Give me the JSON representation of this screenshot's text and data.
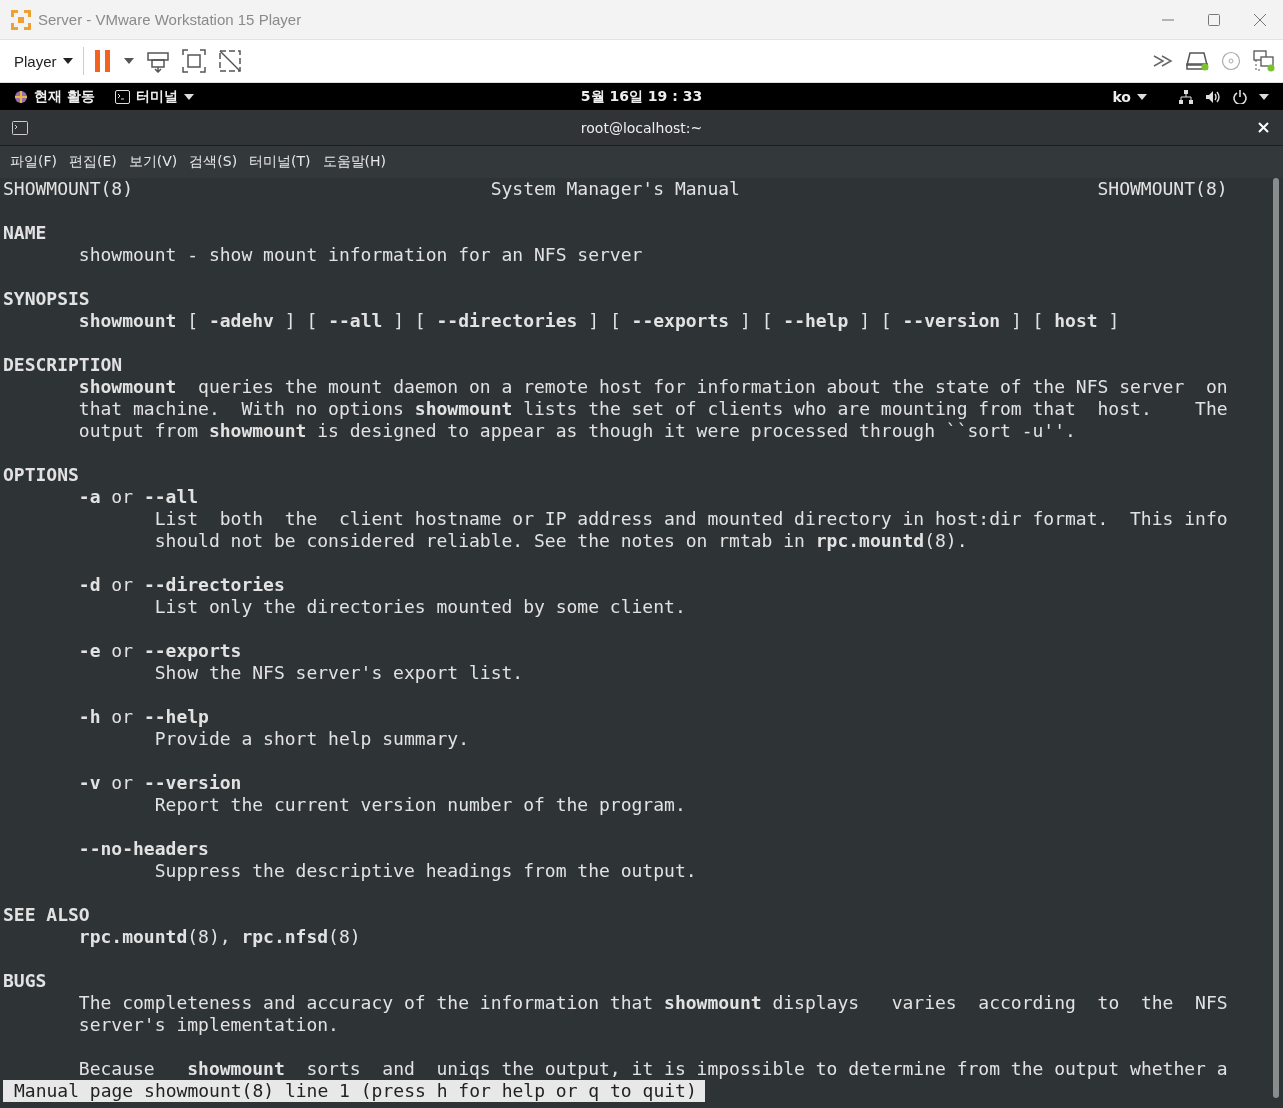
{
  "window": {
    "title": "Server - VMware Workstation 15 Player"
  },
  "toolbar": {
    "player_menu": "Player"
  },
  "top_bar": {
    "activities": "현재 활동",
    "app_menu": "터미널",
    "clock": "5월 16일 19 : 33",
    "input_method": "ko"
  },
  "terminal": {
    "title": "root@localhost:~",
    "menu": [
      "파일(F)",
      "편집(E)",
      "보기(V)",
      "검색(S)",
      "터미널(T)",
      "도움말(H)"
    ],
    "header": {
      "left": "SHOWMOUNT(8)",
      "center": "System Manager's Manual",
      "right": "SHOWMOUNT(8)"
    },
    "lines": [
      {
        "kind": "blank"
      },
      {
        "kind": "heading",
        "text": "NAME"
      },
      {
        "kind": "body",
        "text": "showmount - show mount information for an NFS server"
      },
      {
        "kind": "blank"
      },
      {
        "kind": "heading",
        "text": "SYNOPSIS"
      },
      {
        "kind": "body",
        "text": "**showmount** [ **-adehv** ] [ **--all** ] [ **--directories** ] [ **--exports** ] [ **--help** ] [ **--version** ] [ **host** ]"
      },
      {
        "kind": "blank"
      },
      {
        "kind": "heading",
        "text": "DESCRIPTION"
      },
      {
        "kind": "body",
        "text": "**showmount**  queries the mount daemon on a remote host for information about the state of the NFS server  on"
      },
      {
        "kind": "body",
        "text": "that machine.  With no options **showmount** lists the set of clients who are mounting from that  host.    The"
      },
      {
        "kind": "body",
        "text": "output from **showmount** is designed to appear as though it were processed through ``sort -u''."
      },
      {
        "kind": "blank"
      },
      {
        "kind": "heading",
        "text": "OPTIONS"
      },
      {
        "kind": "body",
        "text": "**-a** or **--all**"
      },
      {
        "kind": "detail",
        "text": "List  both  the  client hostname or IP address and mounted directory in host:dir format.  This info"
      },
      {
        "kind": "detail",
        "text": "should not be considered reliable. See the notes on rmtab in **rpc.mountd**(8)."
      },
      {
        "kind": "blank"
      },
      {
        "kind": "body",
        "text": "**-d** or **--directories**"
      },
      {
        "kind": "detail",
        "text": "List only the directories mounted by some client."
      },
      {
        "kind": "blank"
      },
      {
        "kind": "body",
        "text": "**-e** or **--exports**"
      },
      {
        "kind": "detail",
        "text": "Show the NFS server's export list."
      },
      {
        "kind": "blank"
      },
      {
        "kind": "body",
        "text": "**-h** or **--help**"
      },
      {
        "kind": "detail",
        "text": "Provide a short help summary."
      },
      {
        "kind": "blank"
      },
      {
        "kind": "body",
        "text": "**-v** or **--version**"
      },
      {
        "kind": "detail",
        "text": "Report the current version number of the program."
      },
      {
        "kind": "blank"
      },
      {
        "kind": "body-bold",
        "text": "--no-headers"
      },
      {
        "kind": "detail",
        "text": "Suppress the descriptive headings from the output."
      },
      {
        "kind": "blank"
      },
      {
        "kind": "heading",
        "text": "SEE ALSO"
      },
      {
        "kind": "body",
        "text": "**rpc.mountd**(8), **rpc.nfsd**(8)"
      },
      {
        "kind": "blank"
      },
      {
        "kind": "heading",
        "text": "BUGS"
      },
      {
        "kind": "body",
        "text": "The completeness and accuracy of the information that **showmount** displays   varies  according  to  the  NFS"
      },
      {
        "kind": "body",
        "text": "server's implementation."
      },
      {
        "kind": "blank"
      },
      {
        "kind": "body",
        "text": "Because   **showmount**  sorts  and  uniqs the output, it is impossible to determine from the output whether a"
      }
    ],
    "status": "Manual page showmount(8) line 1 (press h for help or q to quit)"
  }
}
